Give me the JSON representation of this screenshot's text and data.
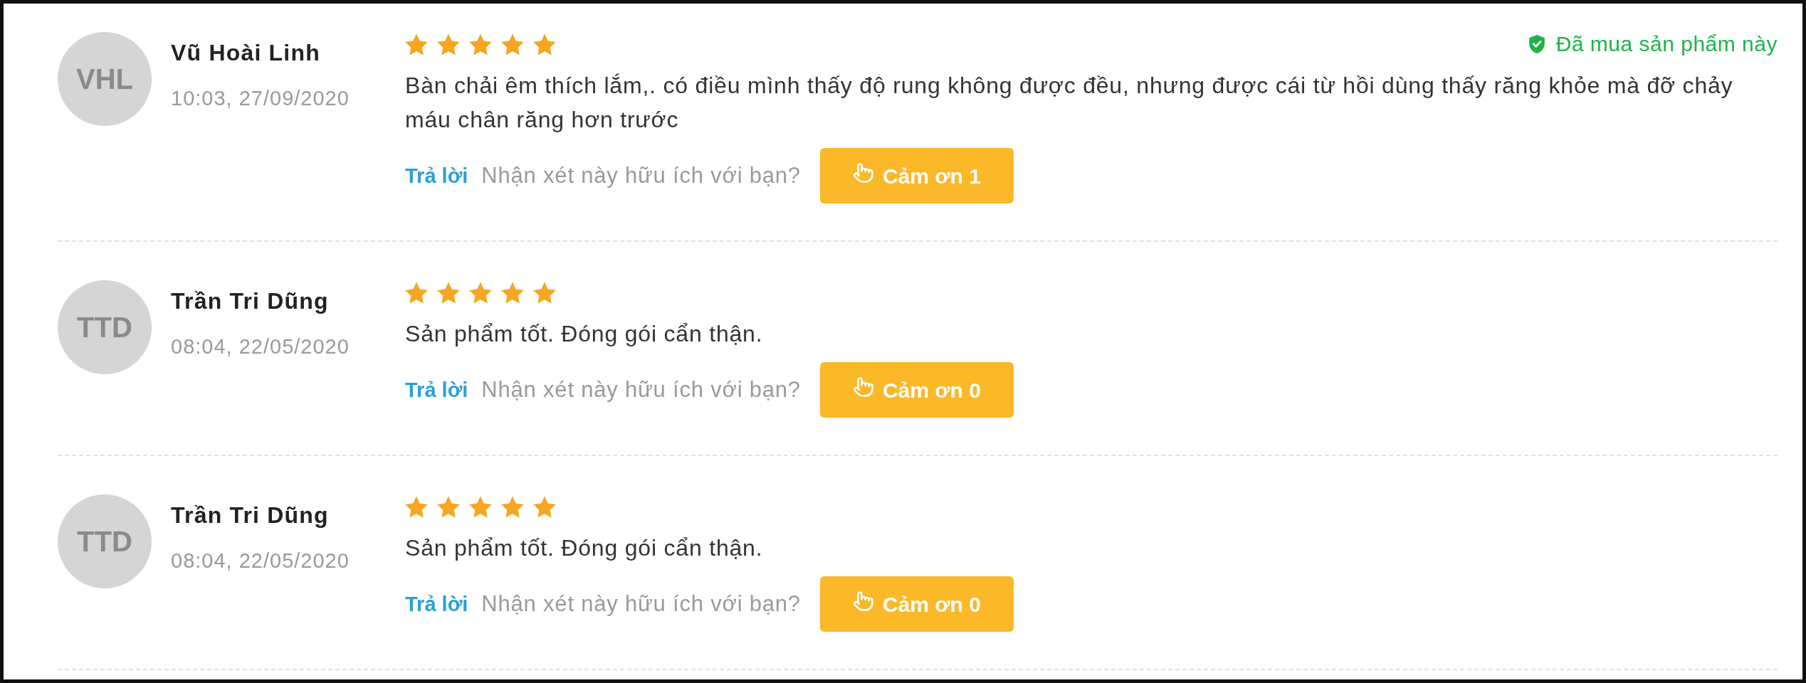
{
  "reviews": [
    {
      "initials": "VHL",
      "name": "Vũ Hoài Linh",
      "time": "10:03, 27/09/2020",
      "stars": 5,
      "badge": "Đã mua sản phẩm này",
      "text": "Bàn chải êm thích lắm,. có điều mình thấy độ rung không được đều, nhưng được cái từ hồi dùng thấy răng khỏe mà đỡ chảy máu chân răng hơn trước",
      "reply": "Trả lời",
      "helpful_prompt": "Nhận xét này hữu ích với bạn?",
      "thanks_button": "Cảm ơn 1"
    },
    {
      "initials": "TTD",
      "name": "Trần Tri Dũng",
      "time": "08:04, 22/05/2020",
      "stars": 5,
      "text": "Sản phẩm tốt. Đóng gói cẩn thận.",
      "reply": "Trả lời",
      "helpful_prompt": "Nhận xét này hữu ích với bạn?",
      "thanks_button": "Cảm ơn 0"
    },
    {
      "initials": "TTD",
      "name": "Trần Tri Dũng",
      "time": "08:04, 22/05/2020",
      "stars": 5,
      "text": "Sản phẩm tốt. Đóng gói cẩn thận.",
      "reply": "Trả lời",
      "helpful_prompt": "Nhận xét này hữu ích với bạn?",
      "thanks_button": "Cảm ơn 0"
    }
  ]
}
